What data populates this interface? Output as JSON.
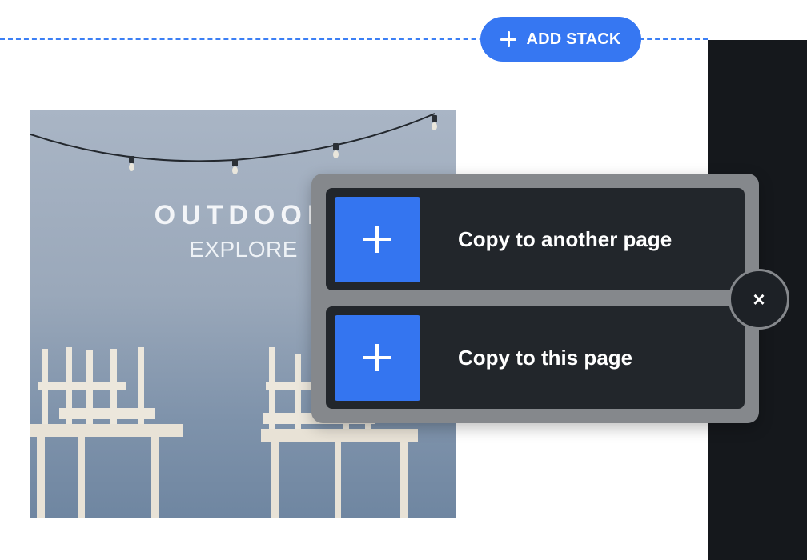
{
  "toolbar": {
    "add_stack_label": "ADD STACK",
    "add_stack_icon": "plus-icon"
  },
  "stack_preview": {
    "title": "OUTDOOR",
    "subtitle": "EXPLORE"
  },
  "copy_menu": {
    "options": [
      {
        "label": "Copy to another page",
        "icon": "plus-icon"
      },
      {
        "label": "Copy to this page",
        "icon": "plus-icon"
      }
    ],
    "close_label": "×",
    "close_icon": "close-icon"
  },
  "colors": {
    "accent": "#3677f2",
    "panel_dark": "#15181c",
    "menu_frame": "#85888c",
    "menu_item": "#22262b"
  }
}
